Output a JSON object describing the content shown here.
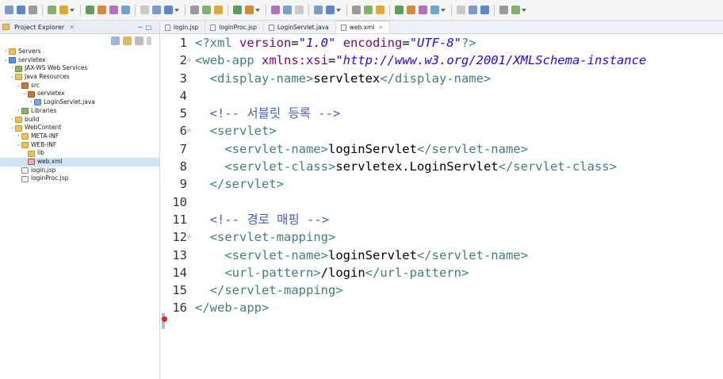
{
  "explorer": {
    "title": "Project Explorer",
    "close": "✕",
    "tree": [
      {
        "label": "Servers",
        "indent": 0,
        "twisty": "›",
        "icon": "folder"
      },
      {
        "label": "servletex",
        "indent": 0,
        "twisty": "⌄",
        "icon": "project"
      },
      {
        "label": "JAX-WS Web Services",
        "indent": 1,
        "twisty": "›",
        "icon": "lib"
      },
      {
        "label": "Java Resources",
        "indent": 1,
        "twisty": "⌄",
        "icon": "folder"
      },
      {
        "label": "src",
        "indent": 2,
        "twisty": "⌄",
        "icon": "pkg"
      },
      {
        "label": "servletex",
        "indent": 3,
        "twisty": "⌄",
        "icon": "pkg"
      },
      {
        "label": "LoginServlet.java",
        "indent": 4,
        "twisty": "›",
        "icon": "java"
      },
      {
        "label": "Libraries",
        "indent": 2,
        "twisty": "›",
        "icon": "lib"
      },
      {
        "label": "build",
        "indent": 1,
        "twisty": "›",
        "icon": "folder"
      },
      {
        "label": "WebContent",
        "indent": 1,
        "twisty": "⌄",
        "icon": "folder"
      },
      {
        "label": "META-INF",
        "indent": 2,
        "twisty": "›",
        "icon": "folder"
      },
      {
        "label": "WEB-INF",
        "indent": 2,
        "twisty": "⌄",
        "icon": "folder"
      },
      {
        "label": "lib",
        "indent": 3,
        "twisty": "",
        "icon": "folder"
      },
      {
        "label": "web.xml",
        "indent": 3,
        "twisty": "",
        "icon": "xmlf",
        "selected": true
      },
      {
        "label": "login.jsp",
        "indent": 2,
        "twisty": "",
        "icon": "file"
      },
      {
        "label": "loginProc.jsp",
        "indent": 2,
        "twisty": "",
        "icon": "file"
      }
    ]
  },
  "tabs": [
    {
      "label": "login.jsp",
      "active": false
    },
    {
      "label": "loginProc.jsp",
      "active": false
    },
    {
      "label": "LoginServlet.java",
      "active": false
    },
    {
      "label": "web.xml",
      "active": true,
      "close": "✕"
    }
  ],
  "code": [
    {
      "num": "1",
      "fold": "",
      "tokens": [
        [
          "t-tag",
          "<?"
        ],
        [
          "t-tag",
          "xml "
        ],
        [
          "t-attr",
          "version"
        ],
        [
          "t-text",
          "="
        ],
        [
          "t-val",
          "\"1.0\""
        ],
        [
          "t-text",
          " "
        ],
        [
          "t-attr",
          "encoding"
        ],
        [
          "t-text",
          "="
        ],
        [
          "t-val",
          "\"UTF-8\""
        ],
        [
          "t-tag",
          "?>"
        ]
      ]
    },
    {
      "num": "2",
      "fold": "⊖",
      "tokens": [
        [
          "t-tag",
          "<web-app "
        ],
        [
          "t-attr",
          "xmlns:xsi"
        ],
        [
          "t-text",
          "="
        ],
        [
          "t-val",
          "\"http://www.w3.org/2001/XMLSchema-instance"
        ]
      ]
    },
    {
      "num": "3",
      "fold": "",
      "tokens": [
        [
          "t-text",
          "  "
        ],
        [
          "t-tag",
          "<display-name>"
        ],
        [
          "t-text",
          "servletex"
        ],
        [
          "t-tag",
          "</display-name>"
        ]
      ]
    },
    {
      "num": "4",
      "fold": "",
      "tokens": []
    },
    {
      "num": "5",
      "fold": "",
      "tokens": [
        [
          "t-text",
          "  "
        ],
        [
          "t-comment",
          "<!-- 서블릿 등록 -->"
        ]
      ]
    },
    {
      "num": "6",
      "fold": "⊖",
      "tokens": [
        [
          "t-text",
          "  "
        ],
        [
          "t-tag",
          "<servlet>"
        ]
      ]
    },
    {
      "num": "7",
      "fold": "",
      "tokens": [
        [
          "t-text",
          "    "
        ],
        [
          "t-tag",
          "<servlet-name>"
        ],
        [
          "t-text",
          "loginServlet"
        ],
        [
          "t-tag",
          "</servlet-name>"
        ]
      ]
    },
    {
      "num": "8",
      "fold": "",
      "tokens": [
        [
          "t-text",
          "    "
        ],
        [
          "t-tag",
          "<servlet-class>"
        ],
        [
          "t-text",
          "servletex.LoginServlet"
        ],
        [
          "t-tag",
          "</servlet-class>"
        ]
      ]
    },
    {
      "num": "9",
      "fold": "",
      "tokens": [
        [
          "t-text",
          "  "
        ],
        [
          "t-tag",
          "</servlet>"
        ]
      ]
    },
    {
      "num": "10",
      "fold": "",
      "tokens": []
    },
    {
      "num": "11",
      "fold": "",
      "tokens": [
        [
          "t-text",
          "  "
        ],
        [
          "t-comment",
          "<!-- 경로 매핑 -->"
        ]
      ]
    },
    {
      "num": "12",
      "fold": "⊖",
      "tokens": [
        [
          "t-text",
          "  "
        ],
        [
          "t-tag",
          "<servlet-mapping>"
        ]
      ]
    },
    {
      "num": "13",
      "fold": "",
      "tokens": [
        [
          "t-text",
          "    "
        ],
        [
          "t-tag",
          "<servlet-name>"
        ],
        [
          "t-text",
          "loginServlet"
        ],
        [
          "t-tag",
          "</servlet-name>"
        ]
      ]
    },
    {
      "num": "14",
      "fold": "",
      "tokens": [
        [
          "t-text",
          "    "
        ],
        [
          "t-tag",
          "<url-pattern>"
        ],
        [
          "t-text",
          "/login"
        ],
        [
          "t-tag",
          "</url-pattern>"
        ]
      ]
    },
    {
      "num": "15",
      "fold": "",
      "tokens": [
        [
          "t-text",
          "  "
        ],
        [
          "t-tag",
          "</servlet-mapping>"
        ]
      ]
    },
    {
      "num": "16",
      "fold": "",
      "tokens": [
        [
          "t-tag",
          "</web-app>"
        ]
      ]
    }
  ],
  "colors": {
    "tag": "#3f7f7f",
    "attr": "#7f007f",
    "value": "#2a00ff",
    "comment": "#3f5fbf",
    "error": "#d9262b"
  },
  "toolbar_icons": [
    "new-icon",
    "save-icon",
    "print-icon",
    "debug-icon",
    "run-icon",
    "external-tools-icon",
    "search-icon",
    "back-icon",
    "forward-icon",
    "open-perspective-icon"
  ]
}
